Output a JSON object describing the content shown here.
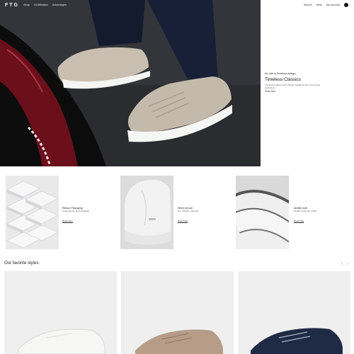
{
  "nav": {
    "logo": "FTG",
    "links": [
      "Shop",
      "Ut Affiliation",
      "Advantages"
    ],
    "right_links": [
      "Search",
      "Help",
      "My account"
    ],
    "bag_icon": "bag-icon"
  },
  "hero": {
    "eyebrow": "An ode to timeless design.",
    "title": "Timeless Classics",
    "description": "The ECS-G Sport Court, Beast. Designed. Our Community welcomed.",
    "cta": "Shop Now"
  },
  "features": [
    {
      "title": "Reduce Packaging",
      "subtitle": "Unboxing the finest detailee",
      "link": "Read story"
    },
    {
      "title": "Where we are",
      "subtitle": "Our specific materials",
      "link": "Read blog"
    },
    {
      "title": "Identify tools",
      "subtitle": "Details made the Ultras",
      "link": "Read blog"
    }
  ],
  "favorites": {
    "title": "Our favorite styles.",
    "prev_icon": "chevron-left-icon",
    "next_icon": "chevron-right-icon",
    "products": [
      {
        "color": "#f3f3f1"
      },
      {
        "color": "#b79d87"
      },
      {
        "color": "#1f2a44"
      }
    ]
  },
  "colors": {
    "hero_background": "#2a2b2f",
    "sneaker": "#c9bfb1",
    "car_red": "#7a1320"
  }
}
